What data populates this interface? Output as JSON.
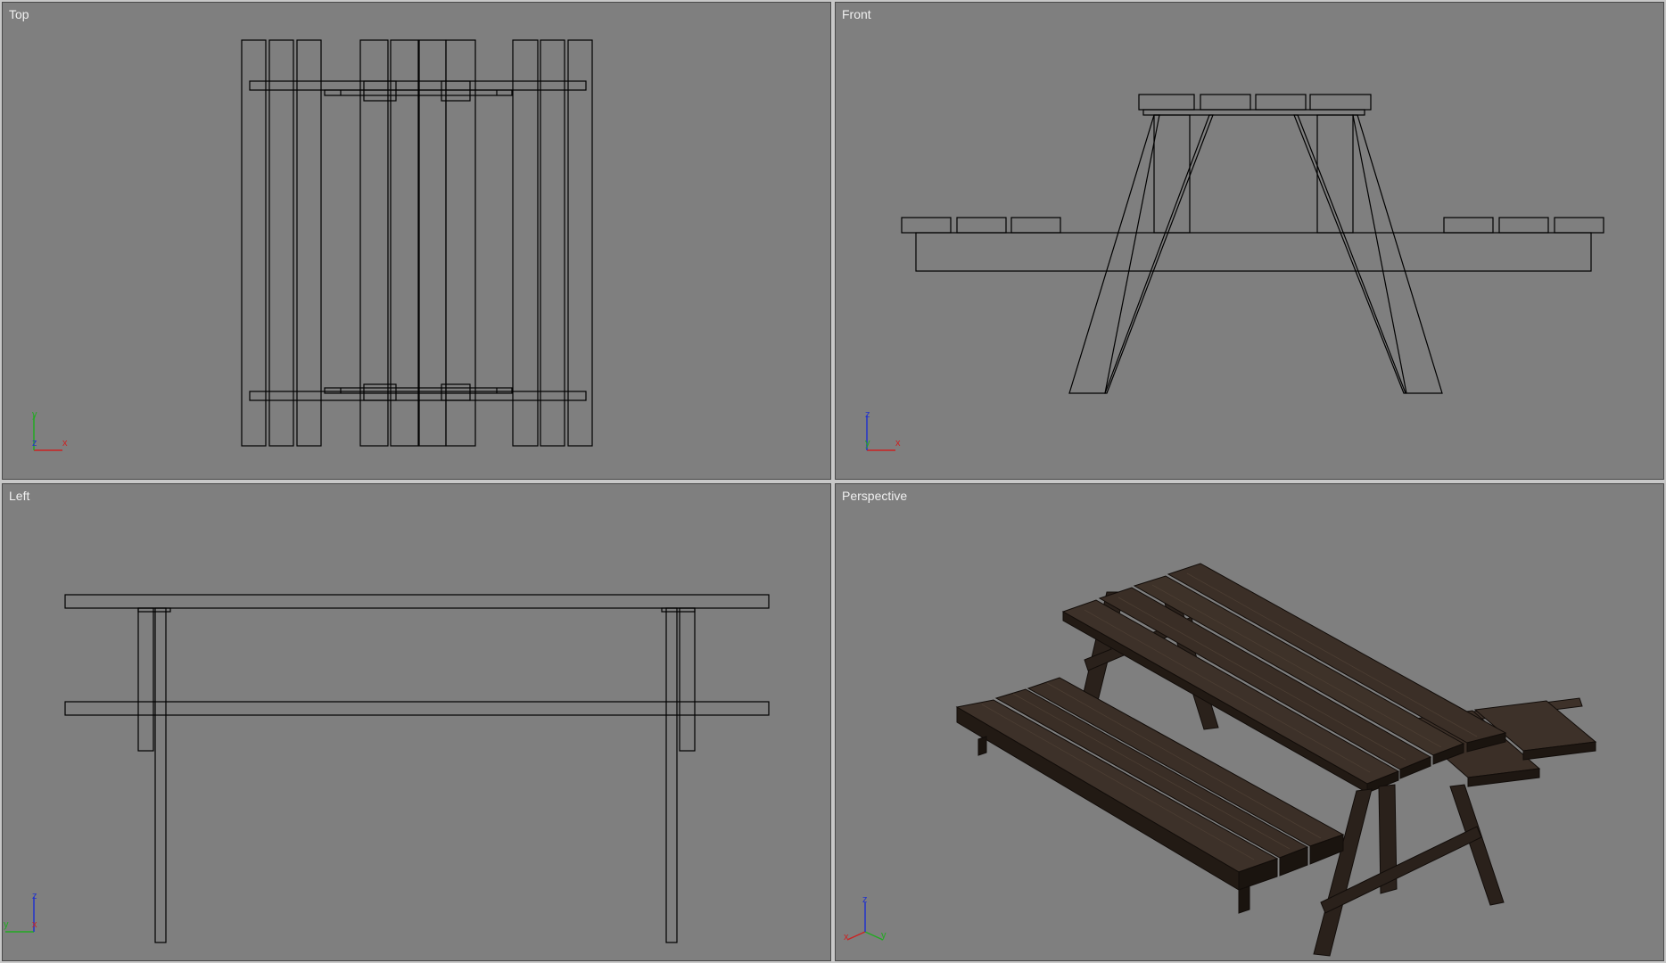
{
  "viewports": {
    "top": {
      "label": "Top",
      "axes": {
        "up": "y",
        "right": "x",
        "depth": "z"
      }
    },
    "front": {
      "label": "Front",
      "axes": {
        "up": "z",
        "right": "x",
        "depth": "y"
      }
    },
    "left": {
      "label": "Left",
      "axes": {
        "up": "z",
        "left": "y",
        "right": "x"
      }
    },
    "perspective": {
      "label": "Perspective",
      "axes": {
        "up": "z",
        "left": "x",
        "right": "y"
      }
    }
  },
  "colors": {
    "viewport_bg": "#7f7f7f",
    "frame": "#c8c8c8",
    "wireframe": "#000000",
    "axis_x": "#cc2222",
    "axis_y": "#22aa22",
    "axis_z": "#2233cc",
    "wood_top": "#3d3129",
    "wood_side": "#221a14",
    "wood_edge": "#120d0a"
  }
}
